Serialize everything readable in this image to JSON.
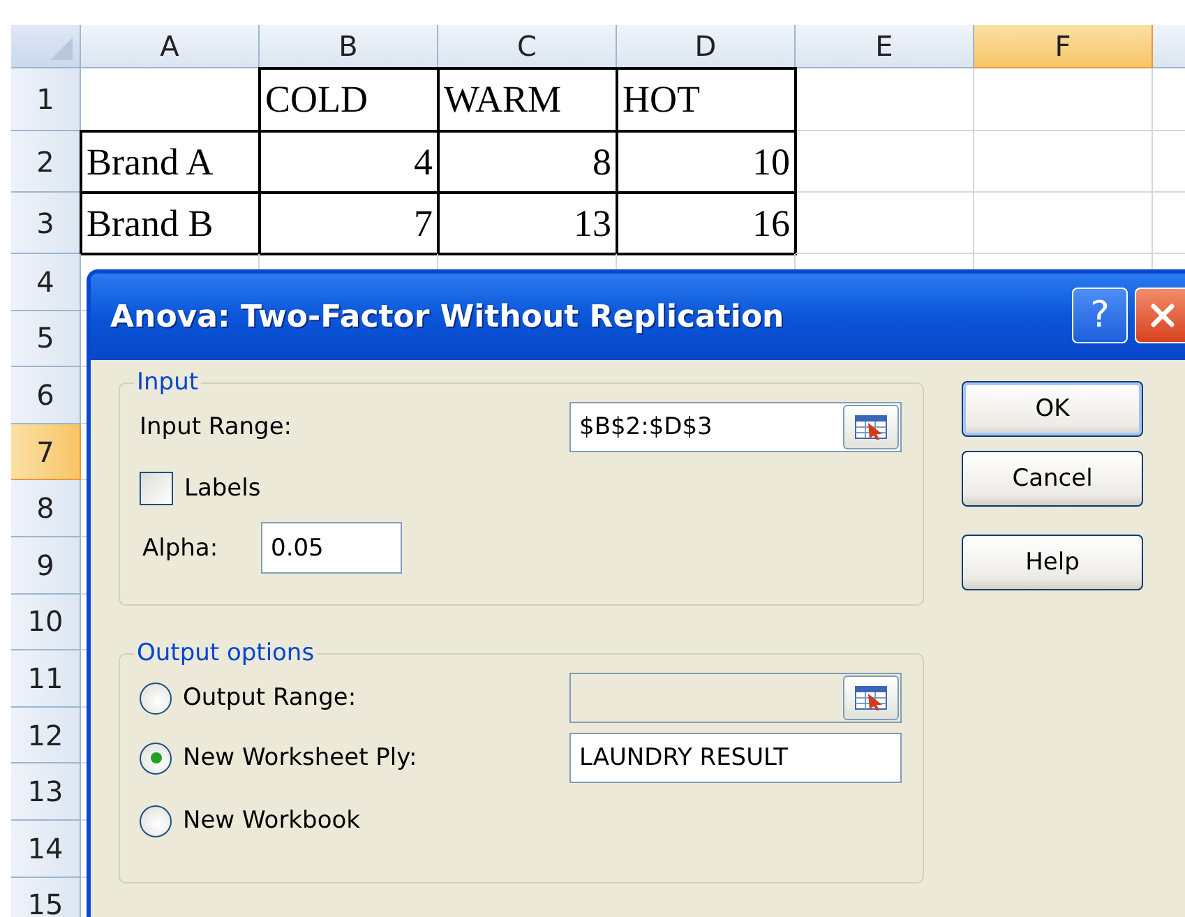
{
  "spreadsheet": {
    "columns": [
      {
        "label": "A",
        "selected": false
      },
      {
        "label": "B",
        "selected": false
      },
      {
        "label": "C",
        "selected": false
      },
      {
        "label": "D",
        "selected": false
      },
      {
        "label": "E",
        "selected": false
      },
      {
        "label": "F",
        "selected": true
      }
    ],
    "rows": [
      {
        "number": "1",
        "selected": false,
        "cells": [
          {
            "kind": "blank"
          },
          {
            "text": "COLD",
            "kind": "text",
            "bordered": true
          },
          {
            "text": "WARM",
            "kind": "text",
            "bordered": true
          },
          {
            "text": "HOT",
            "kind": "text",
            "bordered": true
          }
        ]
      },
      {
        "number": "2",
        "selected": false,
        "cells": [
          {
            "text": "Brand A",
            "kind": "text",
            "bordered": true
          },
          {
            "text": "4",
            "kind": "number",
            "bordered": true
          },
          {
            "text": "8",
            "kind": "number",
            "bordered": true
          },
          {
            "text": "10",
            "kind": "number",
            "bordered": true
          }
        ]
      },
      {
        "number": "3",
        "selected": false,
        "cells": [
          {
            "text": "Brand B",
            "kind": "text",
            "bordered": true
          },
          {
            "text": "7",
            "kind": "number",
            "bordered": true
          },
          {
            "text": "13",
            "kind": "number",
            "bordered": true
          },
          {
            "text": "16",
            "kind": "number",
            "bordered": true
          }
        ]
      },
      {
        "number": "4",
        "selected": false
      },
      {
        "number": "5",
        "selected": false
      },
      {
        "number": "6",
        "selected": false
      },
      {
        "number": "7",
        "selected": true
      },
      {
        "number": "8",
        "selected": false
      },
      {
        "number": "9",
        "selected": false
      },
      {
        "number": "10",
        "selected": false
      },
      {
        "number": "11",
        "selected": false
      },
      {
        "number": "12",
        "selected": false
      },
      {
        "number": "13",
        "selected": false
      },
      {
        "number": "14",
        "selected": false
      },
      {
        "number": "15",
        "selected": false
      }
    ]
  },
  "dialog": {
    "title": "Anova: Two-Factor Without Replication",
    "help_button": "?",
    "input_group": {
      "legend": "Input",
      "input_range": {
        "label": "Input Range:",
        "value": "$B$2:$D$3"
      },
      "labels": {
        "label": "Labels",
        "checked": false
      },
      "alpha": {
        "label": "Alpha:",
        "value": "0.05"
      }
    },
    "output_group": {
      "legend": "Output options",
      "options": [
        {
          "label": "Output Range:",
          "selected": false,
          "kind": "range",
          "disabled": true
        },
        {
          "label": "New Worksheet Ply:",
          "selected": true,
          "kind": "name",
          "value": "LAUNDRY RESULT"
        },
        {
          "label": "New Workbook",
          "selected": false,
          "kind": "none"
        }
      ]
    },
    "buttons": [
      "OK",
      "Cancel",
      "Help"
    ]
  }
}
